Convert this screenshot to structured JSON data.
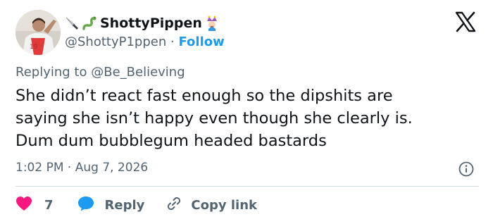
{
  "tweet": {
    "display_name": "ShottyPippen",
    "handle": "@ShottyP1ppen",
    "separator": "·",
    "follow_label": "Follow",
    "replying_prefix": "Replying to",
    "replying_to": "@Be_Believing",
    "text_lines": [
      "She didn’t react fast enough so the dipshits are",
      "saying she isn’t happy even though she clearly is.",
      "Dum dum bubblegum headed bastards"
    ],
    "time": "1:02 PM",
    "date": "Aug 7, 2026",
    "like_count": "7",
    "reply_label": "Reply",
    "copy_link_label": "Copy link"
  },
  "icons": {
    "name_emojis": [
      "knife-icon",
      "snake-icon"
    ],
    "trailing_emoji": "joker-icon",
    "logo": "x-logo-icon",
    "info": "info-icon",
    "like": "heart-icon",
    "reply": "speech-bubble-icon",
    "copy": "link-icon"
  },
  "colors": {
    "link_blue": "#1d9bf0",
    "like_red": "#f91880",
    "secondary_text": "#536471",
    "primary_text": "#0f1419"
  }
}
